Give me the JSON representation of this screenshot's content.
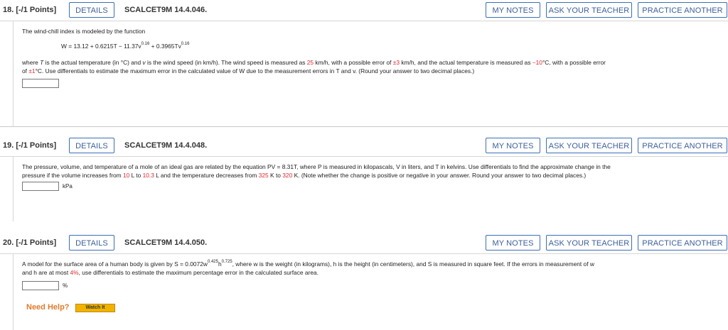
{
  "buttons": {
    "details": "DETAILS",
    "my_notes": "MY NOTES",
    "ask_teacher": "ASK YOUR TEACHER",
    "practice": "PRACTICE ANOTHER"
  },
  "q18": {
    "number": "18. [-/1 Points]",
    "code": "SCALCET9M 14.4.046.",
    "intro": "The wind-chill index is modeled by the function",
    "formula_a": "W = 13.12 + 0.6215T − 11.37v",
    "exp1": "0.16",
    "formula_b": " + 0.3965Tv",
    "exp2": "0.16",
    "line1_a": "where ",
    "line1_b": "T",
    "line1_c": " is the actual temperature (in °C) and ",
    "line1_d": "v",
    "line1_e": " is the wind speed (in km/h). The wind speed is measured as ",
    "wind": "25",
    "line1_f": " km/h, with a possible error of ",
    "wind_err": "±3",
    "line1_g": " km/h, and the actual temperature is measured as ",
    "temp": "−10",
    "line1_h": "°C, with a possible error",
    "line2_a": "of ",
    "temp_err": "±1",
    "line2_b": "°C. Use differentials to estimate the maximum error in the calculated value of W due to the measurement errors in T and v. (Round your answer to two decimal places.)"
  },
  "q19": {
    "number": "19. [-/1 Points]",
    "code": "SCALCET9M 14.4.048.",
    "line1": "The pressure, volume, and temperature of a mole of an ideal gas are related by the equation PV = 8.31T, where P is measured in kilopascals, V in liters, and T in kelvins. Use differentials to find the approximate change in the",
    "line2_a": "pressure if the volume increases from ",
    "v1": "10",
    "line2_b": " L to ",
    "v2": "10.3",
    "line2_c": " L and the temperature decreases from ",
    "t1": "325",
    "line2_d": " K to ",
    "t2": "320",
    "line2_e": " K. (Note whether the change is positive or negative in your answer. Round your answer to two decimal places.)",
    "unit": "kPa"
  },
  "q20": {
    "number": "20. [-/1 Points]",
    "code": "SCALCET9M 14.4.050.",
    "line1_a": "A model for the surface area of a human body is given by S = 0.0072w",
    "exp1": "0.425",
    "line1_b": "h",
    "exp2": "0.725",
    "line1_c": ", where w is the weight (in kilograms), h is the height (in centimeters), and S is measured in square feet. If the errors in measurement of w",
    "line2_a": "and h are at most ",
    "pct": "4%",
    "line2_b": ", use differentials to estimate the maximum percentage error in the calculated surface area.",
    "unit": "%",
    "need_help": "Need Help?",
    "watch": "Watch It"
  },
  "colors": {
    "accent": "#3b6fb6",
    "red": "#e2262d",
    "help": "#e07a2b",
    "watch": "#f0b400"
  }
}
